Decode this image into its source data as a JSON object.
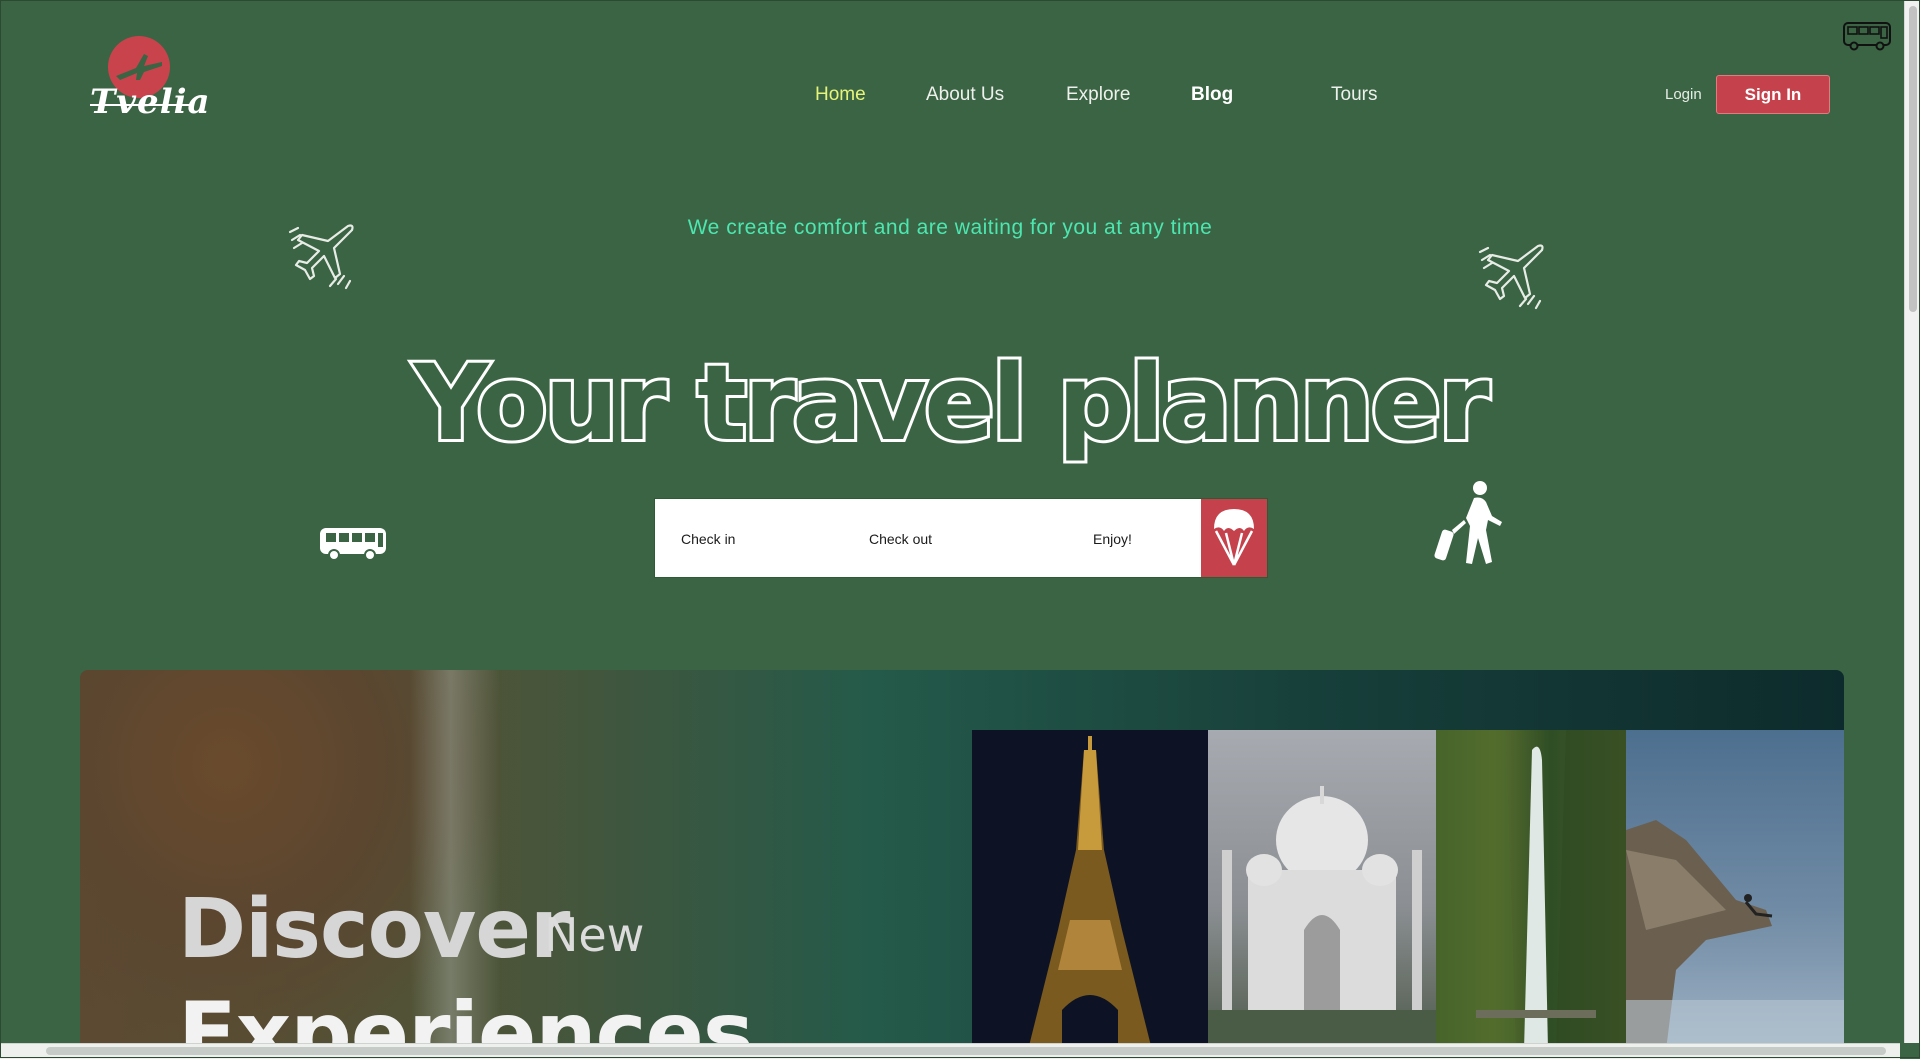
{
  "brand": {
    "name": "Tvelia",
    "accent": "#c5424c",
    "background": "#3a6443"
  },
  "nav": {
    "items": [
      {
        "label": "Home",
        "state": "active"
      },
      {
        "label": "About Us"
      },
      {
        "label": "Explore"
      },
      {
        "label": "Blog"
      },
      {
        "label": "Tours"
      }
    ]
  },
  "auth": {
    "login_label": "Login",
    "signin_label": "Sign In"
  },
  "hero": {
    "tagline": "We create comfort and are waiting for you at any time",
    "title": "Your travel planner"
  },
  "search": {
    "check_in": "Check in",
    "check_out": "Check out",
    "enjoy": "Enjoy!",
    "submit_icon": "parachute-icon"
  },
  "banner": {
    "word1": "Discover",
    "word2": "New",
    "word3": "Experiences",
    "photos": [
      "eiffel-tower",
      "taj-mahal",
      "waterfall",
      "cliff-edge"
    ]
  },
  "icons": [
    "logo-plane-icon",
    "bus-icon",
    "plane-icon",
    "traveler-icon"
  ]
}
